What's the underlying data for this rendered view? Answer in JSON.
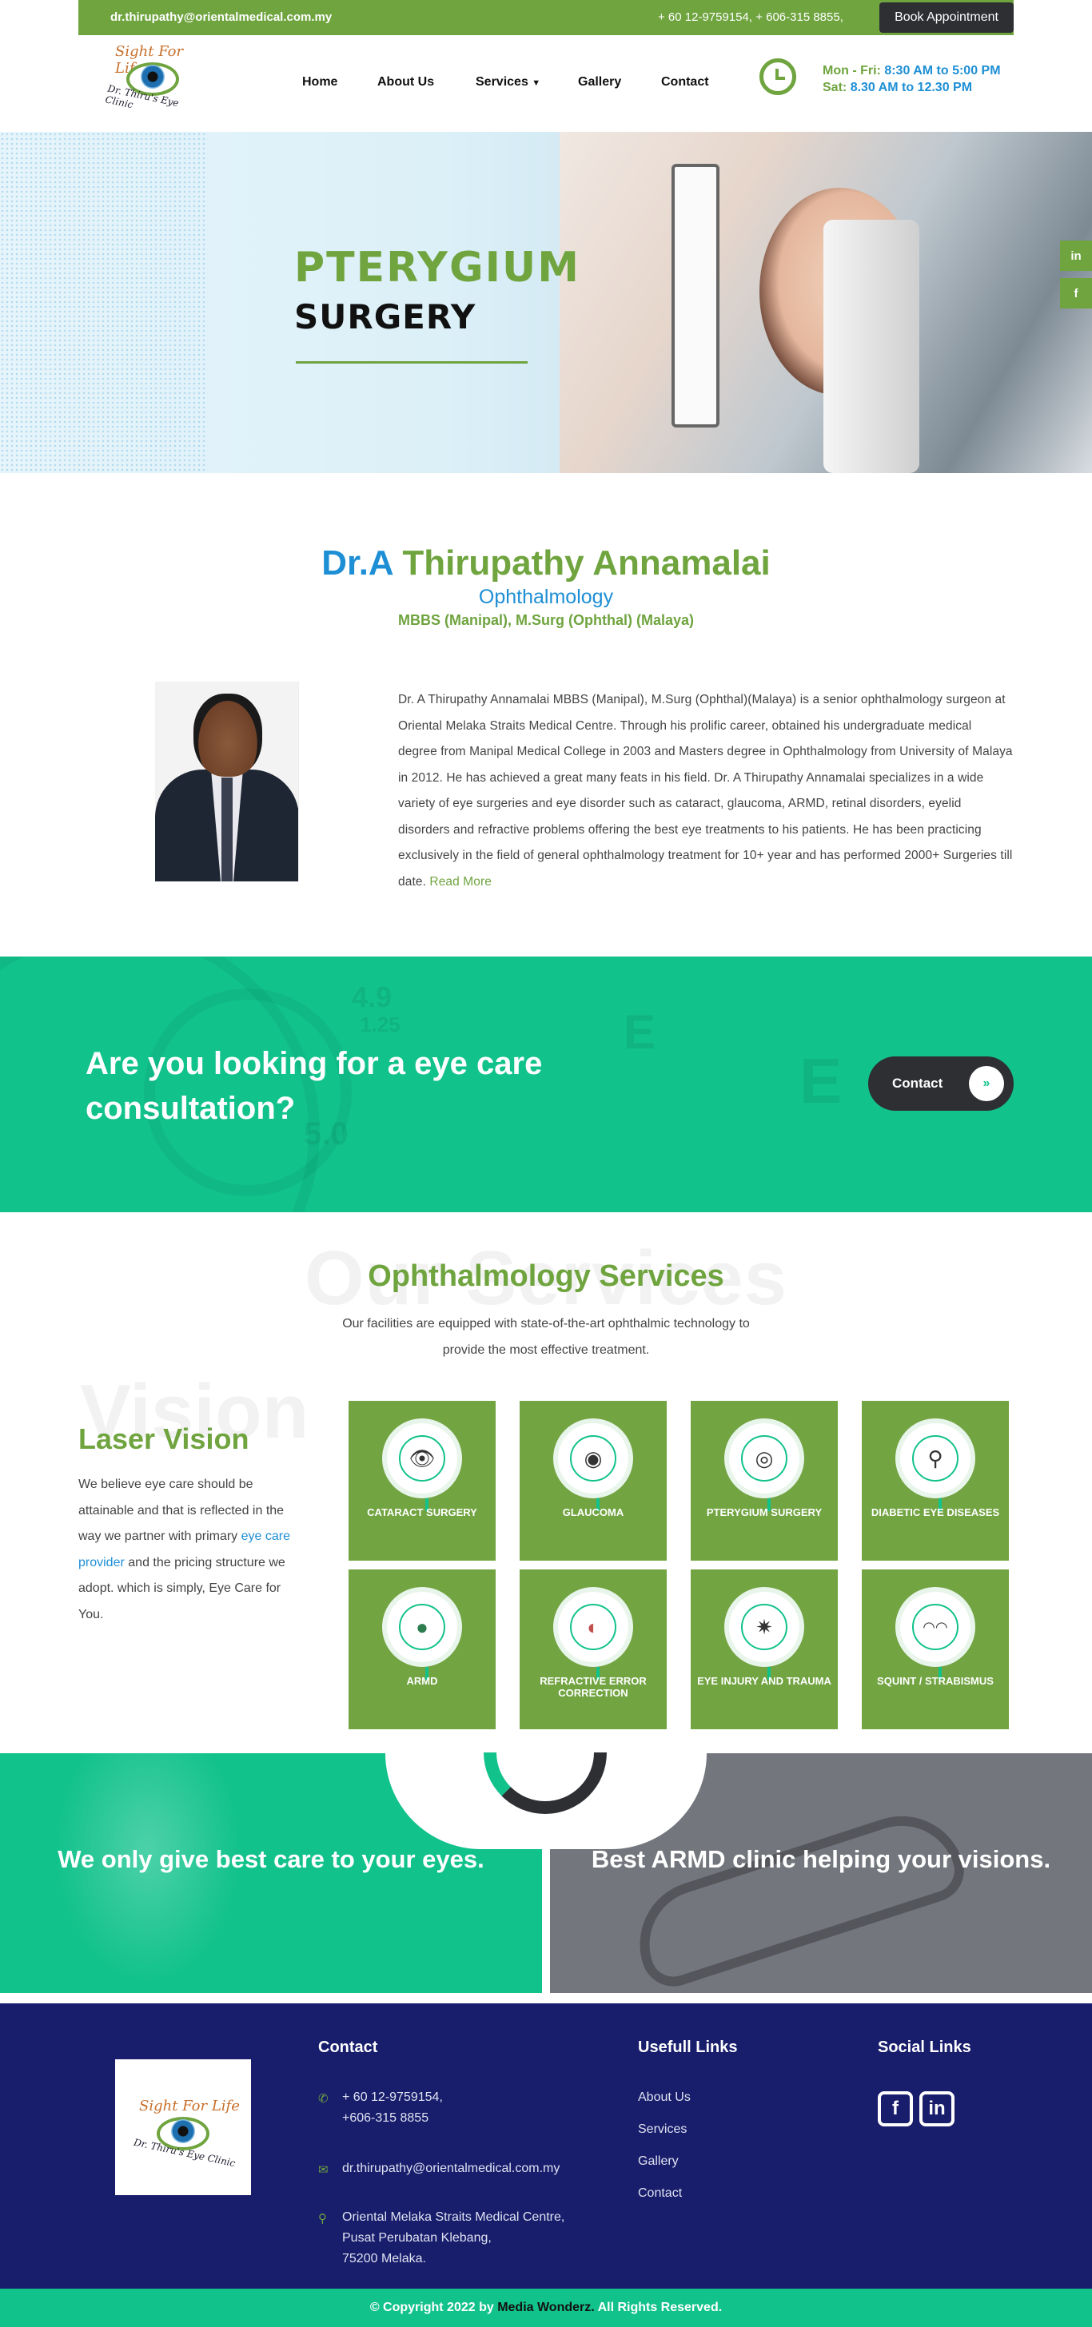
{
  "topbar": {
    "email": "dr.thirupathy@orientalmedical.com.my",
    "phones": "+ 60 12-9759154, + 606-315 8855,",
    "book_label": "Book Appointment"
  },
  "logo": {
    "line1": "Sight For Life",
    "line2": "Dr. Thiru's Eye Clinic"
  },
  "nav": {
    "home": "Home",
    "about": "About Us",
    "services": "Services",
    "gallery": "Gallery",
    "contact": "Contact"
  },
  "hours": {
    "weekday_label": "Mon - Fri:",
    "weekday_time": "8:30 AM to 5:00 PM",
    "sat_label": "Sat:",
    "sat_time": "8.30 AM to 12.30 PM"
  },
  "hero": {
    "title_line1": "PTERYGIUM",
    "title_line2": "SURGERY"
  },
  "side_social": {
    "linkedin": "in",
    "facebook": "f"
  },
  "doctor": {
    "prefix": "Dr.A",
    "name": "Thirupathy Annamalai",
    "specialty": "Ophthalmology",
    "qualifications": "MBBS (Manipal), M.Surg (Ophthal) (Malaya)",
    "bio": "Dr. A Thirupathy Annamalai MBBS (Manipal), M.Surg (Ophthal)(Malaya) is a senior ophthalmology surgeon at Oriental Melaka Straits Medical Centre. Through his prolific career, obtained his undergraduate medical degree from Manipal Medical College in 2003 and Masters degree in Ophthalmology from University of Malaya in 2012. He has achieved a great many feats in his field. Dr. A Thirupathy Annamalai specializes in a wide variety of eye surgeries and eye disorder such as cataract, glaucoma, ARMD, retinal disorders, eyelid disorders and refractive problems offering the best eye treatments to his patients. He has been practicing exclusively in the field of general ophthalmology treatment for 10+ year and has performed 2000+ Surgeries till date.",
    "read_more": "Read More"
  },
  "cta": {
    "heading": "Are you looking for a eye care consultation?",
    "button_label": "Contact",
    "button_arrow": "»",
    "deco": [
      "4.9",
      "1.25",
      "5.0",
      "E",
      "E"
    ]
  },
  "services": {
    "ghost": "Our Services",
    "title": "Ophthalmology Services",
    "subtitle_line1": "Our facilities are equipped with state-of-the-art ophthalmic technology to",
    "subtitle_line2": "provide the most effective treatment.",
    "side_ghost": "Vision",
    "side_title": "Laser Vision",
    "side_text_1": "We believe eye care should be attainable and that is reflected in the way we partner with primary",
    "side_link": "eye care provider",
    "side_text_2": "and the pricing structure we adopt. which is simply, Eye Care for You.",
    "items": [
      {
        "label": "CATARACT SURGERY",
        "icon": "👁"
      },
      {
        "label": "GLAUCOMA",
        "icon": "◉"
      },
      {
        "label": "PTERYGIUM SURGERY",
        "icon": "◎"
      },
      {
        "label": "DIABETIC EYE DISEASES",
        "icon": "⚲"
      },
      {
        "label": "ARMD",
        "icon": "●"
      },
      {
        "label": "REFRACTIVE ERROR CORRECTION",
        "icon": "◐"
      },
      {
        "label": "EYE INJURY AND TRAUMA",
        "icon": "✷"
      },
      {
        "label": "SQUINT / STRABISMUS",
        "icon": "◠◠"
      }
    ]
  },
  "banners": {
    "left": "We only give best care to your eyes.",
    "right": "Best ARMD clinic helping your visions."
  },
  "footer": {
    "contact_heading": "Contact",
    "phone_1": "+ 60 12-9759154,",
    "phone_2": "+606-315 8855",
    "email": "dr.thirupathy@orientalmedical.com.my",
    "address_1": "Oriental Melaka Straits Medical Centre,",
    "address_2": "Pusat Perubatan Klebang,",
    "address_3": "75200 Melaka.",
    "links_heading": "Usefull Links",
    "links": [
      "About Us",
      "Services",
      "Gallery",
      "Contact"
    ],
    "social_heading": "Social Links",
    "social_facebook": "f",
    "social_linkedin": "in"
  },
  "copyright": {
    "prefix": "© Copyright 2022 by",
    "company": "Media Wonderz.",
    "suffix": "All Rights Reserved."
  },
  "colors": {
    "green": "#6fa43f",
    "teal": "#12c28b",
    "blue": "#1e8fd5",
    "navy": "#181d6c",
    "dark": "#2d2f33"
  }
}
